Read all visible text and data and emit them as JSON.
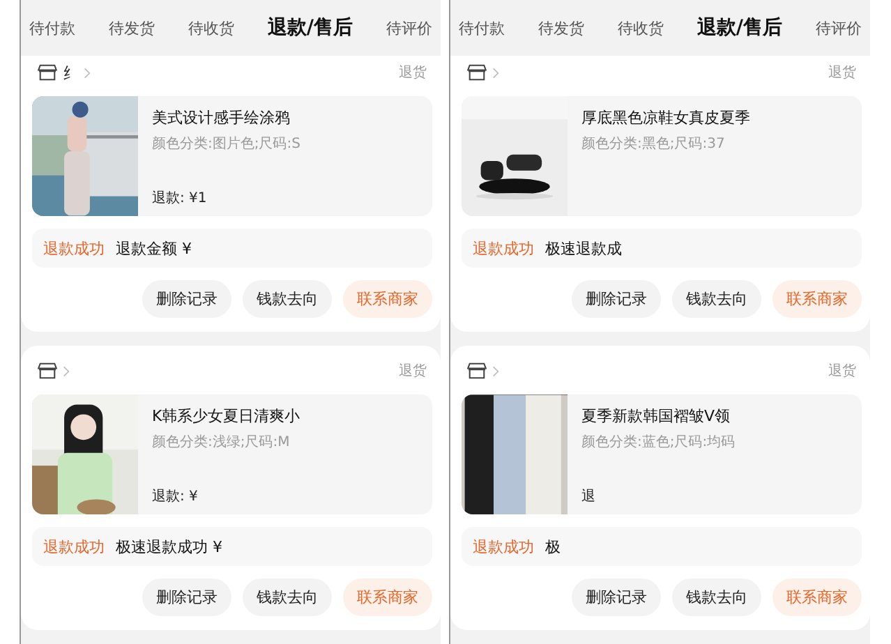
{
  "panes": [
    {
      "tabs": [
        {
          "label": "待付款",
          "selected": false
        },
        {
          "label": "待发货",
          "selected": false
        },
        {
          "label": "待收货",
          "selected": false
        },
        {
          "label": "退款/售后",
          "selected": true
        },
        {
          "label": "待评价",
          "selected": false
        }
      ],
      "orders": [
        {
          "shop": "纟",
          "return_tag": "退货",
          "title": "美式设计感手绘涂鸦",
          "spec": "颜色分类:图片色;尺码:S",
          "refund": "退款: ¥1",
          "status": "退款成功",
          "note": "退款金额 ¥",
          "buttons": [
            {
              "label": "删除记录",
              "kind": "plain"
            },
            {
              "label": "钱款去向",
              "kind": "plain"
            },
            {
              "label": "联系商家",
              "kind": "accent"
            }
          ]
        },
        {
          "return_tag": "退货",
          "title": "K韩系少女夏日清爽小",
          "spec": "颜色分类:浅绿;尺码:M",
          "refund": "退款: ¥",
          "status": "退款成功",
          "note": "极速退款成功 ¥",
          "buttons": [
            {
              "label": "删除记录",
              "kind": "plain"
            },
            {
              "label": "钱款去向",
              "kind": "plain"
            },
            {
              "label": "联系商家",
              "kind": "accent"
            }
          ]
        }
      ]
    },
    {
      "tabs": [
        {
          "label": "待付款",
          "selected": false
        },
        {
          "label": "待发货",
          "selected": false
        },
        {
          "label": "待收货",
          "selected": false
        },
        {
          "label": "退款/售后",
          "selected": true
        },
        {
          "label": "待评价",
          "selected": false
        }
      ],
      "orders": [
        {
          "return_tag": "退货",
          "title": "厚底黑色凉鞋女真皮夏季",
          "spec": "颜色分类:黑色;尺码:37",
          "status": "退款成功",
          "note": "极速退款成",
          "buttons": [
            {
              "label": "删除记录",
              "kind": "plain"
            },
            {
              "label": "钱款去向",
              "kind": "plain"
            },
            {
              "label": "联系商家",
              "kind": "accent"
            }
          ]
        },
        {
          "return_tag": "退货",
          "title": "夏季新款韩国褶皱V领",
          "spec": "颜色分类:蓝色;尺码:均码",
          "refund": "退",
          "status": "退款成功",
          "note": "极",
          "buttons": [
            {
              "label": "删除记录",
              "kind": "plain"
            },
            {
              "label": "钱款去向",
              "kind": "plain"
            },
            {
              "label": "联系商家",
              "kind": "accent"
            }
          ]
        }
      ]
    }
  ]
}
